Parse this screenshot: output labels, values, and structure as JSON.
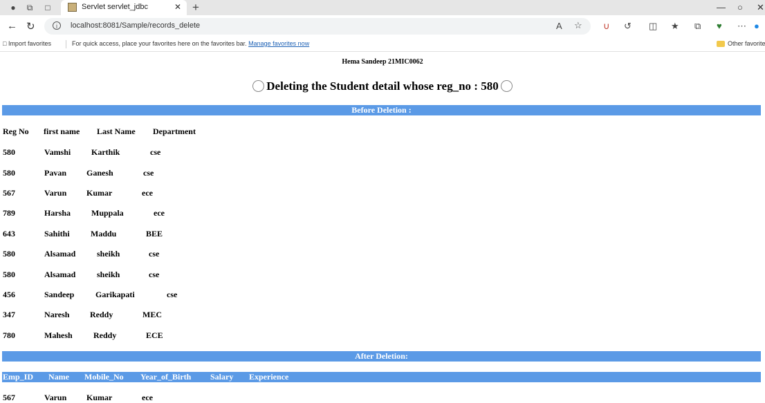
{
  "browser": {
    "tab_title": "Servlet servlet_jdbc",
    "url": "localhost:8081/Sample/records_delete",
    "favorites": {
      "import": "Import favorites",
      "hint": "For quick access, place your favorites here on the favorites bar.",
      "manage": "Manage favorites now",
      "other": "Other favorite"
    }
  },
  "page": {
    "author": "Hema Sandeep 21MIC0062",
    "heading": "Deleting the Student detail whose reg_no : 580",
    "before_label": "Before Deletion :",
    "after_label": "After Deletion:",
    "before_headers": [
      "Reg No",
      "first name",
      "Last Name",
      "Department"
    ],
    "before_rows": [
      [
        "580",
        "Vamshi",
        "Karthik",
        "cse"
      ],
      [
        "580",
        "Pavan",
        "Ganesh",
        "cse"
      ],
      [
        "567",
        "Varun",
        "Kumar",
        "ece"
      ],
      [
        "789",
        "Harsha",
        "Muppala",
        "ece"
      ],
      [
        "643",
        "Sahithi",
        "Maddu",
        "BEE"
      ],
      [
        "580",
        "Alsamad",
        "sheikh",
        "cse"
      ],
      [
        "580",
        "Alsamad",
        "sheikh",
        "cse"
      ],
      [
        "456",
        "Sandeep",
        "Garikapati",
        "cse"
      ],
      [
        "347",
        "Naresh",
        "Reddy",
        "MEC"
      ],
      [
        "780",
        "Mahesh",
        "Reddy",
        "ECE"
      ]
    ],
    "after_headers": [
      "Emp_ID",
      "Name",
      "Mobile_No",
      "Year_of_Birth",
      "Salary",
      "Experience"
    ],
    "after_rows": [
      [
        "567",
        "Varun",
        "Kumar",
        "ece"
      ]
    ]
  }
}
